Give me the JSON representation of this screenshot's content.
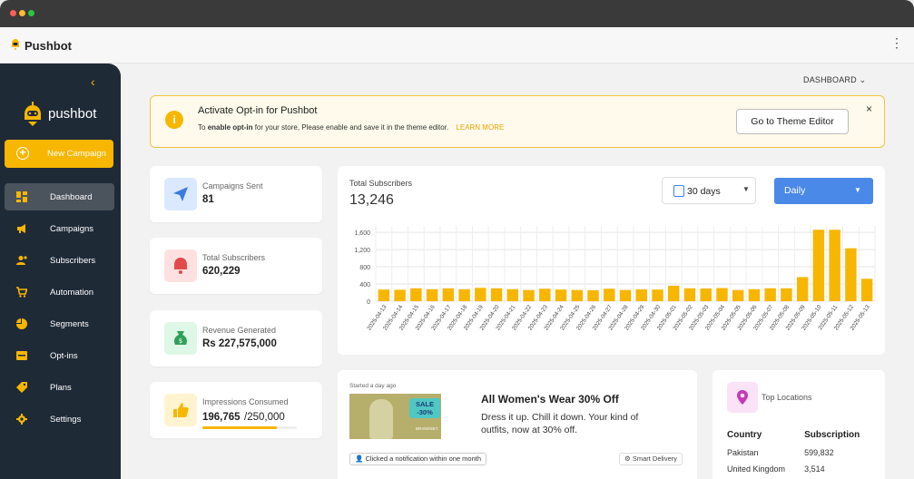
{
  "window": {
    "dots": [
      "#ff5f57",
      "#febc2e",
      "#28c840"
    ]
  },
  "appbar": {
    "title": "Pushbot",
    "more_icon": "more-icon"
  },
  "sidebar": {
    "collapse_icon": "chevron-left-icon",
    "brand": "pushbot",
    "new_campaign": "New Campaign",
    "items": [
      {
        "label": "Dashboard",
        "icon": "dashboard-icon",
        "active": true
      },
      {
        "label": "Campaigns",
        "icon": "megaphone-icon",
        "active": false
      },
      {
        "label": "Subscribers",
        "icon": "users-icon",
        "active": false
      },
      {
        "label": "Automation",
        "icon": "cart-icon",
        "active": false
      },
      {
        "label": "Segments",
        "icon": "pie-icon",
        "active": false
      },
      {
        "label": "Opt-ins",
        "icon": "optin-icon",
        "active": false
      },
      {
        "label": "Plans",
        "icon": "tag-icon",
        "active": false
      },
      {
        "label": "Settings",
        "icon": "gear-icon",
        "active": false
      }
    ],
    "accent": "#f7b600"
  },
  "header": {
    "dashboard_menu": "DASHBOARD"
  },
  "banner": {
    "title": "Activate Opt-in for Pushbot",
    "desc_prefix": "To",
    "desc_bold": "enable opt-in",
    "desc_suffix": "for your store, Please enable and save it in the theme editor.",
    "learn_more": "LEARN MORE",
    "button": "Go to Theme Editor",
    "close": "×"
  },
  "stats": [
    {
      "title": "Campaigns Sent",
      "value": "81",
      "icon": "send-icon",
      "icon_bg": "#dbe9ff"
    },
    {
      "title": "Total Subscribers",
      "value": "620,229",
      "icon": "bell-icon",
      "icon_bg": "#ffe0e0"
    },
    {
      "title": "Revenue Generated",
      "value": "Rs 227,575,000",
      "icon": "money-bag-icon",
      "icon_bg": "#dff7e6"
    },
    {
      "title": "Impressions Consumed",
      "value": "196,765",
      "value_total": "/250,000",
      "progress": 0.787,
      "icon": "thumbs-up-icon",
      "icon_bg": "#fff4cf"
    }
  ],
  "chart_card": {
    "title": "Total Subscribers",
    "total": "13,246",
    "range": "30 days",
    "period": "Daily"
  },
  "chart_data": {
    "type": "bar",
    "categories": [
      "2025-04-13",
      "2025-04-14",
      "2025-04-15",
      "2025-04-16",
      "2025-04-17",
      "2025-04-18",
      "2025-04-19",
      "2025-04-20",
      "2025-04-21",
      "2025-04-22",
      "2025-04-23",
      "2025-04-24",
      "2025-04-25",
      "2025-04-26",
      "2025-04-27",
      "2025-04-28",
      "2025-04-29",
      "2025-04-30",
      "2025-05-01",
      "2025-05-02",
      "2025-05-03",
      "2025-05-04",
      "2025-05-05",
      "2025-05-06",
      "2025-05-07",
      "2025-05-08",
      "2025-05-09",
      "2025-05-10",
      "2025-05-11",
      "2025-05-12",
      "2025-05-13"
    ],
    "values": [
      270,
      265,
      300,
      280,
      300,
      280,
      310,
      300,
      280,
      260,
      290,
      270,
      260,
      255,
      290,
      260,
      275,
      270,
      360,
      300,
      295,
      305,
      260,
      280,
      300,
      300,
      560,
      1660,
      1660,
      1230,
      520
    ],
    "yticks": [
      "0",
      "400",
      "800",
      "1,200",
      "1,600"
    ],
    "ylim": [
      0,
      1750
    ],
    "color": "#f7b600",
    "grid": true
  },
  "notification": {
    "when": "Started a day ago",
    "image": {
      "sale_line1": "SALE",
      "sale_line2": "-30%",
      "tag": "BRANDSET"
    },
    "headline": "All Women's Wear 30% Off",
    "body": "Dress it up. Chill it down. Your kind of outfits, now at 30% off.",
    "clicked": "Clicked a notification within one month",
    "smart": "Smart Delivery"
  },
  "locations": {
    "title": "Top Locations",
    "columns": [
      "Country",
      "Subscription"
    ],
    "rows": [
      [
        "Pakistan",
        "599,832"
      ],
      [
        "United Kingdom",
        "3,514"
      ]
    ]
  }
}
